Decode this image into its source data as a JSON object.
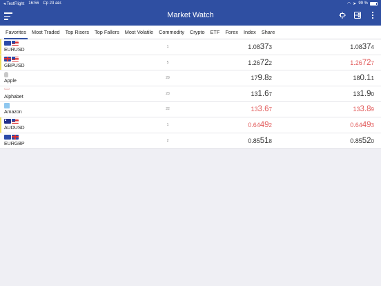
{
  "status": {
    "back_app": "TestFlight",
    "time": "16:56",
    "date": "Ср 23 авг.",
    "battery": "99 %"
  },
  "nav": {
    "title": "Market Watch",
    "icons": [
      "menu-icon",
      "move-icon",
      "layout-icon",
      "more-vertical-icon"
    ]
  },
  "tabs": [
    {
      "label": "Favorites",
      "active": true
    },
    {
      "label": "Most Traded"
    },
    {
      "label": "Top Risers"
    },
    {
      "label": "Top Fallers"
    },
    {
      "label": "Most Volatile"
    },
    {
      "label": "Commodity"
    },
    {
      "label": "Crypto"
    },
    {
      "label": "ETF"
    },
    {
      "label": "Forex"
    },
    {
      "label": "Index"
    },
    {
      "label": "Share"
    }
  ],
  "instruments": [
    {
      "name": "EURUSD",
      "icon": "eu-us-flags",
      "count": "1",
      "bid": {
        "a": "1.08",
        "b": "37",
        "c": "3"
      },
      "ask": {
        "a": "1.08",
        "b": "37",
        "c": "4"
      },
      "bid_color": "#333333",
      "ask_color": "#333333"
    },
    {
      "name": "GBPUSD",
      "icon": "gb-us-flags",
      "count": "5",
      "bid": {
        "a": "1.26",
        "b": "72",
        "c": "2"
      },
      "ask": {
        "a": "1.26",
        "b": "72",
        "c": "7"
      },
      "bid_color": "#333333",
      "ask_color": "#e25b5b"
    },
    {
      "name": "Apple",
      "icon": "apple-logo",
      "count": "29",
      "bid": {
        "a": "17",
        "b": "9.8",
        "c": "2"
      },
      "ask": {
        "a": "18",
        "b": "0.1",
        "c": "1"
      },
      "bid_color": "#333333",
      "ask_color": "#333333"
    },
    {
      "name": "Alphabet",
      "icon": "alphabet-logo",
      "count": "23",
      "bid": {
        "a": "13",
        "b": "1.6",
        "c": "7"
      },
      "ask": {
        "a": "13",
        "b": "1.9",
        "c": "0"
      },
      "bid_color": "#333333",
      "ask_color": "#333333"
    },
    {
      "name": "Amazon",
      "icon": "amazon-logo",
      "count": "22",
      "bid": {
        "a": "13",
        "b": "3.6",
        "c": "7"
      },
      "ask": {
        "a": "13",
        "b": "3.8",
        "c": "9"
      },
      "bid_color": "#e25b5b",
      "ask_color": "#e25b5b"
    },
    {
      "name": "AUDUSD",
      "icon": "au-us-flags",
      "count": "1",
      "bid": {
        "a": "0.64",
        "b": "49",
        "c": "2"
      },
      "ask": {
        "a": "0.64",
        "b": "49",
        "c": "3"
      },
      "bid_color": "#e25b5b",
      "ask_color": "#e25b5b"
    },
    {
      "name": "EURGBP",
      "icon": "eu-gb-flags",
      "count": "2",
      "bid": {
        "a": "0.85",
        "b": "51",
        "c": "8"
      },
      "ask": {
        "a": "0.85",
        "b": "52",
        "c": "0"
      },
      "bid_color": "#333333",
      "ask_color": "#333333"
    }
  ]
}
